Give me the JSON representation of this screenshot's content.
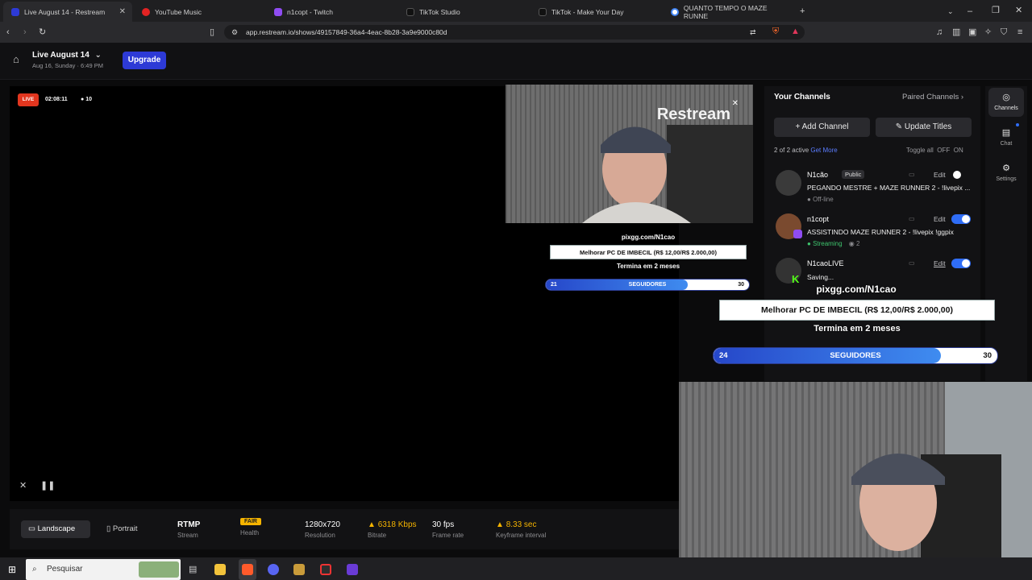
{
  "browser": {
    "tabs": [
      {
        "label": "Live August 14 - Restream",
        "active": true
      },
      {
        "label": "YouTube Music"
      },
      {
        "label": "n1copt - Twitch"
      },
      {
        "label": "TikTok Studio"
      },
      {
        "label": "TikTok - Make Your Day"
      },
      {
        "label": "QUANTO TEMPO O MAZE RUNNE"
      }
    ],
    "url": "app.restream.io/shows/49157849-36a4-4eac-8b28-3a9e9000c80d"
  },
  "header": {
    "title": "Live August 14",
    "subtitle": "Aug 16, Sunday · 6:49 PM",
    "upgrade_label": "Upgrade"
  },
  "stage": {
    "live_badge": "LIVE",
    "timer": "02:08:11",
    "viewers": "10",
    "watermark": "Restream"
  },
  "overlay_small": {
    "link": "pixgg.com/N1cao",
    "goal": "Melhorar PC DE IMBECIL (R$ 12,00/R$ 2.000,00)",
    "ends": "Termina em 2 meses",
    "bar_current": "21",
    "bar_label": "SEGUIDORES",
    "bar_max": "30",
    "bar_fraction": 0.7
  },
  "overlay_large": {
    "link": "pixgg.com/N1cao",
    "goal": "Melhorar PC DE IMBECIL (R$ 12,00/R$ 2.000,00)",
    "ends": "Termina em 2 meses",
    "bar_current": "24",
    "bar_label": "SEGUIDORES",
    "bar_max": "30",
    "bar_fraction": 0.8
  },
  "channels": {
    "title": "Your Channels",
    "paired_label": "Paired Channels",
    "add_channel": "Add Channel",
    "update_titles": "Update Titles",
    "active_count": "2 of 2 active",
    "get_more": "Get More",
    "toggle_all": "Toggle all",
    "off": "OFF",
    "on": "ON",
    "edit_label": "Edit",
    "items": [
      {
        "name": "N1cão",
        "badge": "Public",
        "title": "PEGANDO MESTRE + MAZE RUNNER 2 - !livepix ...",
        "status": "Off-line",
        "enabled": false
      },
      {
        "name": "n1copt",
        "title": "ASSISTINDO MAZE RUNNER 2 - !livepix !ggpix",
        "status": "Streaming",
        "viewers": "2",
        "enabled": true
      },
      {
        "name": "N1caoLIVE",
        "title": "Saving...",
        "status": "",
        "enabled": true
      }
    ]
  },
  "sidebar": {
    "items": [
      {
        "label": "Channels",
        "icon": "channels-icon"
      },
      {
        "label": "Chat",
        "icon": "chat-icon"
      },
      {
        "label": "Settings",
        "icon": "gear-icon"
      }
    ]
  },
  "bottom": {
    "landscape": "Landscape",
    "portrait": "Portrait",
    "stats": [
      {
        "value": "RTMP",
        "label": "Stream"
      },
      {
        "value": "FAIR",
        "label": "Health"
      },
      {
        "value": "1280x720",
        "label": "Resolution"
      },
      {
        "value": "6318 Kbps",
        "label": "Bitrate",
        "warn": true
      },
      {
        "value": "30 fps",
        "label": "Frame rate"
      },
      {
        "value": "8.33 sec",
        "label": "Keyframe interval",
        "warn": true
      }
    ]
  },
  "taskbar": {
    "search_placeholder": "Pesquisar"
  },
  "colors": {
    "accent": "#2d3ad6",
    "live": "#e2361f",
    "toggle_on": "#2f6df6",
    "warn": "#f5b400",
    "streaming": "#3ec46d"
  }
}
